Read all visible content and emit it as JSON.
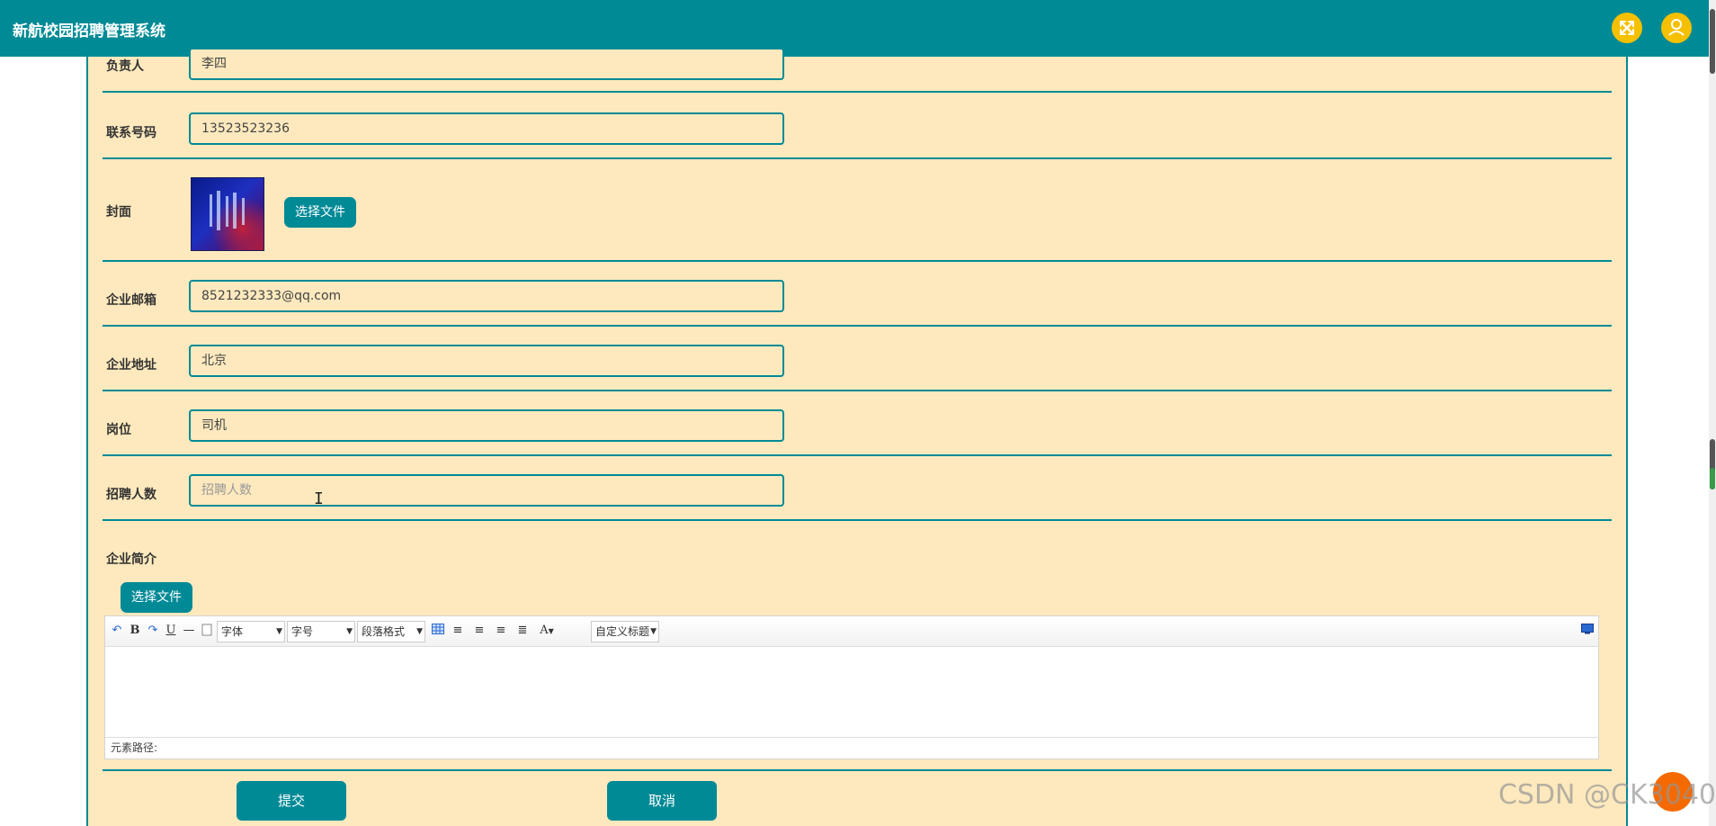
{
  "header": {
    "title": "新航校园招聘管理系统",
    "fullscreen_icon": "fullscreen-icon",
    "user_icon": "user-icon",
    "accent_color": "#008a96",
    "button_color": "#f5c000"
  },
  "form": {
    "owner": {
      "label": "负责人",
      "value": "李四"
    },
    "phone": {
      "label": "联系号码",
      "value": "13523523236"
    },
    "cover": {
      "label": "封面",
      "button": "选择文件"
    },
    "email": {
      "label": "企业邮箱",
      "value": "8521232333@qq.com"
    },
    "address": {
      "label": "企业地址",
      "value": "北京"
    },
    "position": {
      "label": "岗位",
      "value": "司机"
    },
    "headcount": {
      "label": "招聘人数",
      "placeholder": "招聘人数",
      "value": ""
    },
    "intro": {
      "label": "企业简介",
      "button": "选择文件",
      "editor": {
        "toolbar": {
          "undo_icon": "undo-icon",
          "bold": "B",
          "redo_icon": "redo-icon",
          "underline": "U",
          "hr_icon": "horizontal-rule-icon",
          "paste_icon": "paste-icon",
          "font_select": "字体",
          "size_select": "字号",
          "format_select": "段落格式",
          "table_icon": "table-icon",
          "align_left_icon": "align-left-icon",
          "align_right_icon": "align-right-icon",
          "align_center_icon": "align-center-icon",
          "align_justify_icon": "align-justify-icon",
          "font_color": "A",
          "custom_title_select": "自定义标题",
          "fullscreen_icon": "editor-fullscreen-icon"
        },
        "status_path": "元素路径:"
      }
    },
    "submit": "提交",
    "cancel": "取消"
  },
  "watermark": "CSDN @CK3040"
}
